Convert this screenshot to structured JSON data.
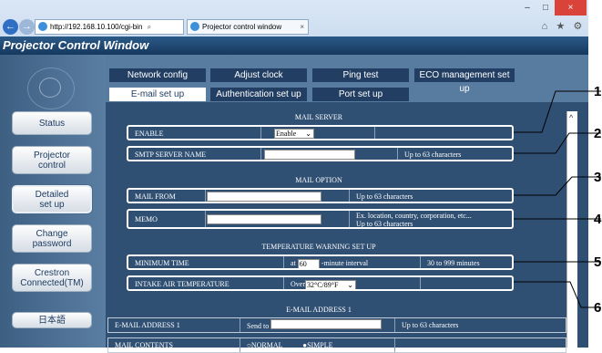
{
  "browser": {
    "url": "http://192.168.10.100/cgi-bin",
    "search_icon_glyph": "⌕",
    "tab_title": "Projector control window",
    "tab_close": "×",
    "back_glyph": "←",
    "forward_glyph": "→",
    "window_buttons": [
      "–",
      "□",
      "×"
    ],
    "toolbar_icons": [
      "⌂",
      "★",
      "⚙"
    ]
  },
  "app": {
    "title": "Projector Control Window"
  },
  "sidebar": {
    "items": [
      {
        "label": "Status"
      },
      {
        "label": "Projector\ncontrol"
      },
      {
        "label": "Detailed\nset up"
      },
      {
        "label": "Change\npassword"
      },
      {
        "label": "Crestron\nConnected(TM)"
      },
      {
        "label": "日本語"
      }
    ]
  },
  "tabs": {
    "row1": [
      "Network config",
      "Adjust clock",
      "Ping test",
      "ECO management set up"
    ],
    "row2": [
      "E-mail set up",
      "Authentication set up",
      "Port set up"
    ]
  },
  "sections": {
    "mail_server": "MAIL SERVER",
    "mail_option": "MAIL OPTION",
    "temp_warning": "TEMPERATURE WARNING SET UP",
    "email_address_1": "E-MAIL ADDRESS 1"
  },
  "rows": {
    "enable": {
      "label": "ENABLE",
      "value": "Enable"
    },
    "smtp": {
      "label": "SMTP SERVER NAME",
      "note": "Up to 63 characters"
    },
    "mail_from": {
      "label": "MAIL FROM",
      "note": "Up to 63 characters"
    },
    "memo": {
      "label": "MEMO",
      "note1": "Ex. location, country, corporation, etc...",
      "note2": "Up to 63 characters"
    },
    "min_time": {
      "label": "MINIMUM TIME",
      "prefix": "at",
      "value": "60",
      "suffix": "-minute interval",
      "note": "30 to 999 minutes"
    },
    "intake": {
      "label": "INTAKE AIR TEMPERATURE",
      "prefix": "Over",
      "value": "32°C/89°F"
    },
    "email1": {
      "label": "E-MAIL ADDRESS 1",
      "prefix": "Send to",
      "note": "Up to 63 characters"
    },
    "mail_contents": {
      "label": "MAIL CONTENTS",
      "opt1": "NORMAL",
      "opt2": "SIMPLE"
    }
  },
  "callouts": [
    "1",
    "2",
    "3",
    "4",
    "5",
    "6"
  ],
  "scrollbar": {
    "up_glyph": "^"
  }
}
